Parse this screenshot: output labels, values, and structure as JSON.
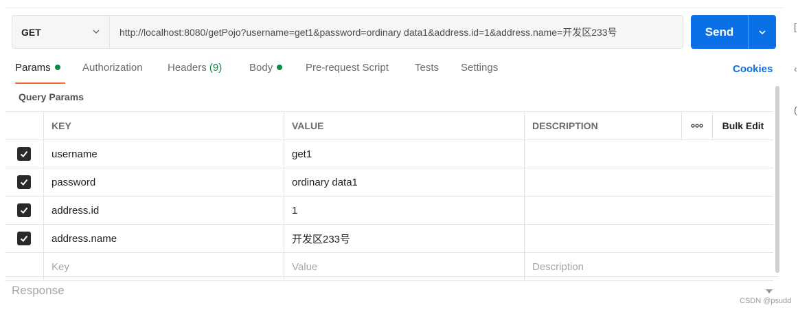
{
  "request": {
    "method": "GET",
    "url": "http://localhost:8080/getPojo?username=get1&password=ordinary data1&address.id=1&address.name=开发区233号",
    "send_label": "Send"
  },
  "tabs": [
    {
      "label": "Params",
      "indicator": "dot"
    },
    {
      "label": "Authorization"
    },
    {
      "label": "Headers",
      "count": "(9)"
    },
    {
      "label": "Body",
      "indicator": "dot"
    },
    {
      "label": "Pre-request Script"
    },
    {
      "label": "Tests"
    },
    {
      "label": "Settings"
    }
  ],
  "cookies_label": "Cookies",
  "query_params_title": "Query Params",
  "table": {
    "headers": {
      "key": "KEY",
      "value": "VALUE",
      "description": "DESCRIPTION",
      "more": "ooo",
      "bulk_edit": "Bulk Edit"
    },
    "rows": [
      {
        "checked": true,
        "key": "username",
        "value": "get1",
        "description": ""
      },
      {
        "checked": true,
        "key": "password",
        "value": "ordinary data1",
        "description": ""
      },
      {
        "checked": true,
        "key": "address.id",
        "value": "1",
        "description": ""
      },
      {
        "checked": true,
        "key": "address.name",
        "value": "开发区233号",
        "description": ""
      }
    ],
    "placeholders": {
      "key": "Key",
      "value": "Value",
      "description": "Description"
    }
  },
  "response_label": "Response",
  "watermark": "CSDN @psudd",
  "sidebar_glyphs": [
    "[",
    "‹",
    "("
  ],
  "colors": {
    "accent": "#0b70e6",
    "active_tab_underline": "#f26b3a",
    "status_dot": "#0c8a3e"
  }
}
